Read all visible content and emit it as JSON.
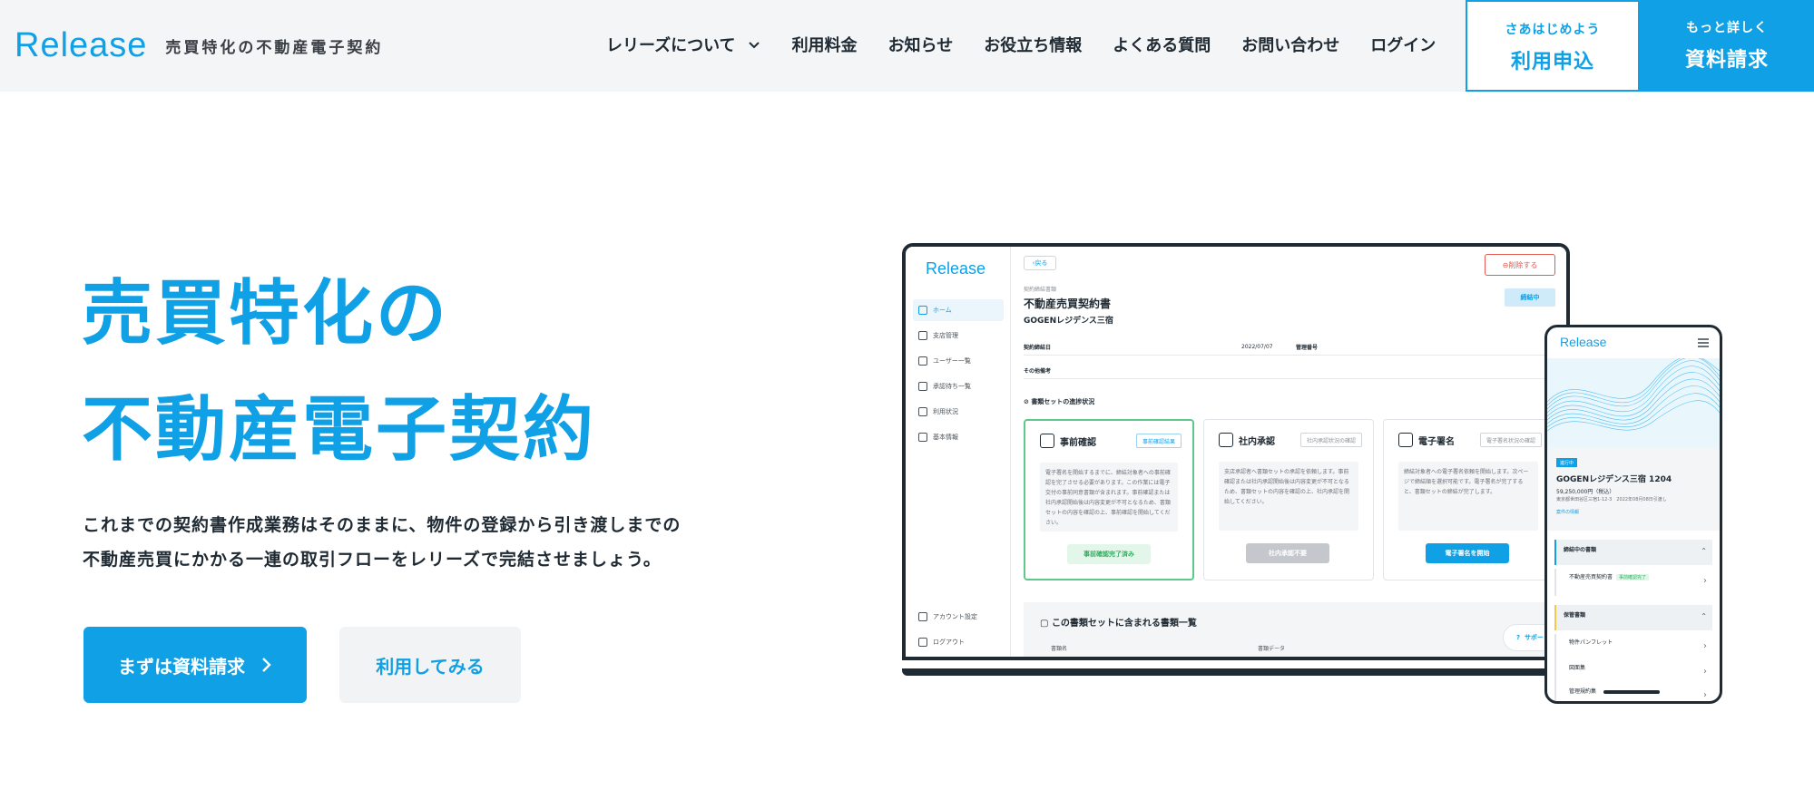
{
  "header": {
    "logo_text": "Release",
    "logo_tagline": "売買特化の不動産電子契約",
    "nav": [
      {
        "label": "レリーズについて",
        "has_dropdown": true
      },
      {
        "label": "利用料金"
      },
      {
        "label": "お知らせ"
      },
      {
        "label": "お役立ち情報"
      },
      {
        "label": "よくある質問"
      },
      {
        "label": "お問い合わせ"
      },
      {
        "label": "ログイン"
      }
    ],
    "apply_button": {
      "sub": "さあはじめよう",
      "main": "利用申込"
    },
    "request_button": {
      "sub": "もっと詳しく",
      "main": "資料請求"
    }
  },
  "hero": {
    "title_lines": [
      "売買特化の",
      "不動産電子契約"
    ],
    "description_lines": [
      "これまでの契約書作成業務はそのままに、物件の登録から引き渡しまでの",
      "不動産売買にかかる一連の取引フローをレリーズで完結させましょう。"
    ],
    "cta_primary": "まずは資料請求",
    "cta_secondary": "利用してみる"
  },
  "laptop_screen": {
    "logo": "Release",
    "menu": [
      "ホーム",
      "支店管理",
      "ユーザー一覧",
      "承認待ち一覧",
      "利用状況",
      "基本情報"
    ],
    "menu_bottom": [
      "アカウント設定",
      "ログアウト"
    ],
    "back": "戻る",
    "delete": "削除する",
    "doc_type_label": "契約締結書類",
    "doc_title": "不動産売買契約書",
    "property": "GOGENレジデンス三宿",
    "status": "締結中",
    "row1": {
      "label": "契約締結日",
      "value": "2022/07/07",
      "label2": "管理番号"
    },
    "row2": {
      "label": "その他備考"
    },
    "section": "書類セットの進捗状況",
    "cards": [
      {
        "title": "事前確認",
        "tag": "事前確認結果",
        "body": "電子署名を開始するまでに、締結対象者への事前確認を完了させる必要があります。この作業には電子交付の事前同意書類が含まれます。事前確認または社内承認開始後は内容変更が不可となるため、書類セットの内容を確認の上、事前確認を開始してください。",
        "button": "事前確認完了済み"
      },
      {
        "title": "社内承認",
        "tag": "社内承認状況の確認",
        "body": "支店承認者へ書類セットの承認を依頼します。事前確認または社内承認開始後は内容変更が不可となるため、書類セットの内容を確認の上、社内承認を開始してください。",
        "button": "社内承認不要"
      },
      {
        "title": "電子署名",
        "tag": "電子署名状況の確認",
        "body": "締結対象者への電子署名依頼を開始します。次ページで締結順を選択可能です。電子署名が完了すると、書類セットの締結が完了します。",
        "button": "電子署名を開始"
      }
    ],
    "list_title": "この書類セットに含まれる書類一覧",
    "list_cols": [
      "書類名",
      "書類データ"
    ],
    "support": "サポート"
  },
  "phone_screen": {
    "logo": "Release",
    "badge": "進行中",
    "property": "GOGENレジデンス三宿 1204",
    "price": "59,250,000円（税込）",
    "address": "東京都世田谷区三宿1-12-3　2022年08月08日引渡し",
    "link": "案件の情報",
    "sections": [
      {
        "label": "締結中の書類",
        "items": [
          {
            "label": "不動産売買契約書",
            "tag": "事前確認完了"
          }
        ]
      },
      {
        "label": "保管書類",
        "items": [
          {
            "label": "物件パンフレット"
          },
          {
            "label": "図面集"
          },
          {
            "label": "管理規約集"
          }
        ]
      }
    ]
  },
  "colors": {
    "brand": "#0fa0e6",
    "header_bg": "#f4f5f7",
    "text": "#1f2a33"
  }
}
